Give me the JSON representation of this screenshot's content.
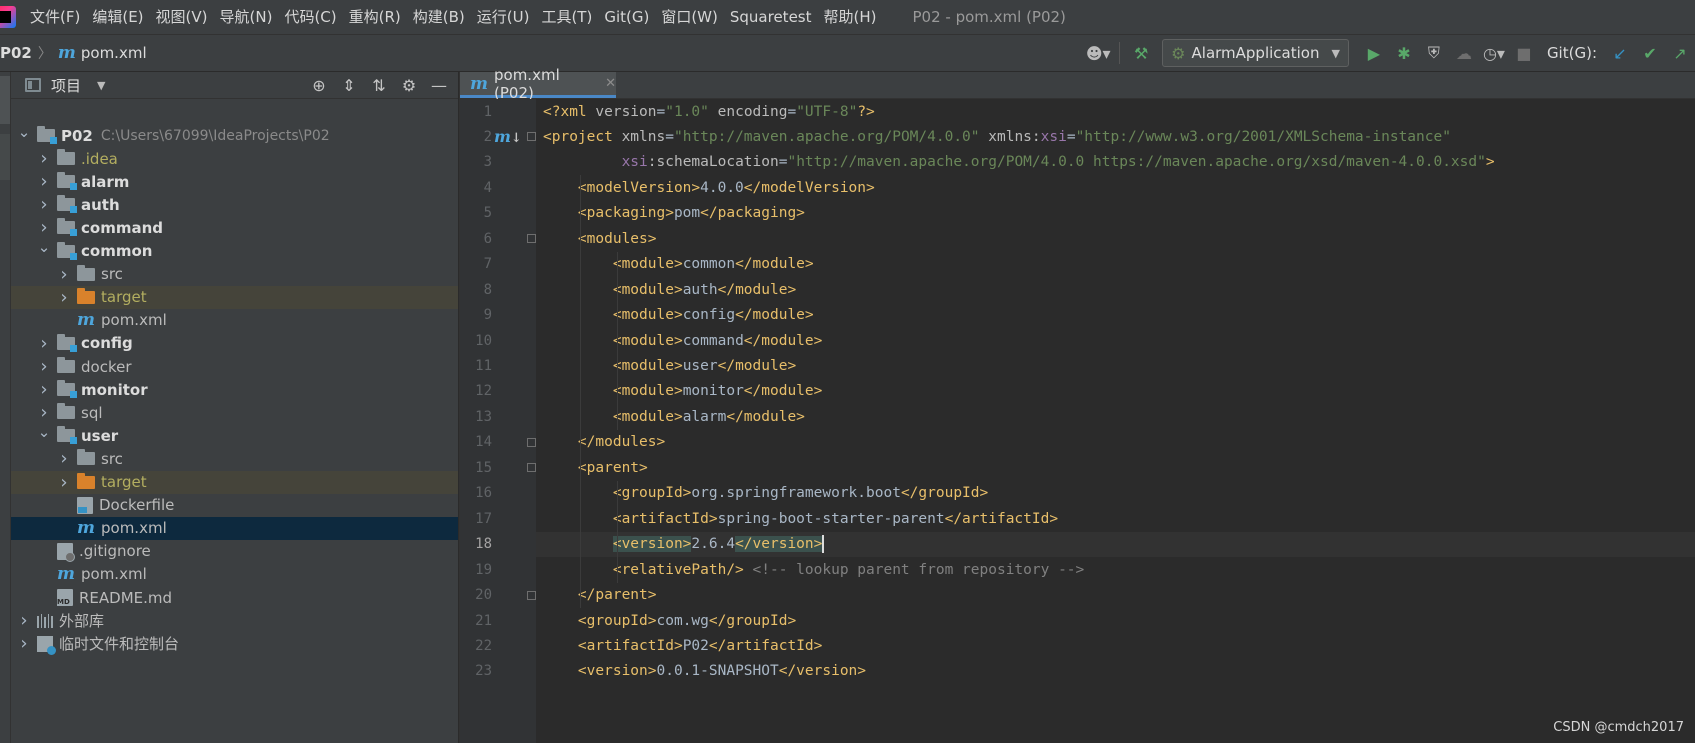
{
  "menubar": {
    "items": [
      "文件(F)",
      "编辑(E)",
      "视图(V)",
      "导航(N)",
      "代码(C)",
      "重构(R)",
      "构建(B)",
      "运行(U)",
      "工具(T)",
      "Git(G)",
      "窗口(W)",
      "Squaretest",
      "帮助(H)"
    ],
    "window_title": "P02 - pom.xml (P02)"
  },
  "navbar": {
    "root": "P02",
    "file": "pom.xml",
    "run_config": "AlarmApplication",
    "git_label": "Git(G):"
  },
  "project_panel": {
    "title": "项目",
    "tree": [
      {
        "label": "P02",
        "path": "C:\\Users\\67099\\IdeaProjects\\P02",
        "depth": 0,
        "expanded": true,
        "kind": "module",
        "bold": true
      },
      {
        "label": ".idea",
        "depth": 1,
        "expanded": false,
        "kind": "folder",
        "style": "idea"
      },
      {
        "label": "alarm",
        "depth": 1,
        "expanded": false,
        "kind": "module",
        "bold": true
      },
      {
        "label": "auth",
        "depth": 1,
        "expanded": false,
        "kind": "module",
        "bold": true
      },
      {
        "label": "command",
        "depth": 1,
        "expanded": false,
        "kind": "module",
        "bold": true
      },
      {
        "label": "common",
        "depth": 1,
        "expanded": true,
        "kind": "module",
        "bold": true
      },
      {
        "label": "src",
        "depth": 2,
        "expanded": false,
        "kind": "folder"
      },
      {
        "label": "target",
        "depth": 2,
        "expanded": false,
        "kind": "folder-orange",
        "style": "target",
        "highlight": true
      },
      {
        "label": "pom.xml",
        "depth": 2,
        "kind": "maven"
      },
      {
        "label": "config",
        "depth": 1,
        "expanded": false,
        "kind": "module",
        "bold": true
      },
      {
        "label": "docker",
        "depth": 1,
        "expanded": false,
        "kind": "folder"
      },
      {
        "label": "monitor",
        "depth": 1,
        "expanded": false,
        "kind": "module",
        "bold": true
      },
      {
        "label": "sql",
        "depth": 1,
        "expanded": false,
        "kind": "folder"
      },
      {
        "label": "user",
        "depth": 1,
        "expanded": true,
        "kind": "module",
        "bold": true
      },
      {
        "label": "src",
        "depth": 2,
        "expanded": false,
        "kind": "folder"
      },
      {
        "label": "target",
        "depth": 2,
        "expanded": false,
        "kind": "folder-orange",
        "style": "target",
        "highlight": true
      },
      {
        "label": "Dockerfile",
        "depth": 2,
        "kind": "docker"
      },
      {
        "label": "pom.xml",
        "depth": 2,
        "kind": "maven",
        "selected": true
      },
      {
        "label": ".gitignore",
        "depth": 1,
        "kind": "git"
      },
      {
        "label": "pom.xml",
        "depth": 1,
        "kind": "maven"
      },
      {
        "label": "README.md",
        "depth": 1,
        "kind": "md"
      },
      {
        "label": "外部库",
        "depth": 0,
        "expanded": false,
        "kind": "lib"
      },
      {
        "label": "临时文件和控制台",
        "depth": 0,
        "expanded": false,
        "kind": "scratch"
      }
    ]
  },
  "editor": {
    "tab_label": "pom.xml (P02)",
    "current_line": 18,
    "lines": [
      [
        [
          "tag",
          "<?xml "
        ],
        [
          "attr",
          "version"
        ],
        [
          "txt",
          "="
        ],
        [
          "val",
          "\"1.0\""
        ],
        [
          "txt",
          " "
        ],
        [
          "attr",
          "encoding"
        ],
        [
          "txt",
          "="
        ],
        [
          "val",
          "\"UTF-8\""
        ],
        [
          "tag",
          "?>"
        ]
      ],
      [
        [
          "tag",
          "<project "
        ],
        [
          "attr",
          "xmlns"
        ],
        [
          "txt",
          "="
        ],
        [
          "val",
          "\"http://maven.apache.org/POM/4.0.0\""
        ],
        [
          "txt",
          " "
        ],
        [
          "attr",
          "xmlns:"
        ],
        [
          "ns",
          "xsi"
        ],
        [
          "txt",
          "="
        ],
        [
          "val",
          "\"http://www.w3.org/2001/XMLSchema-instance\""
        ]
      ],
      [
        [
          "txt",
          "         "
        ],
        [
          "ns",
          "xsi"
        ],
        [
          "attr",
          ":schemaLocation"
        ],
        [
          "txt",
          "="
        ],
        [
          "val",
          "\"http://maven.apache.org/POM/4.0.0 https://maven.apache.org/xsd/maven-4.0.0.xsd\""
        ],
        [
          "tag",
          ">"
        ]
      ],
      [
        [
          "txt",
          "    "
        ],
        [
          "tag",
          "<modelVersion>"
        ],
        [
          "txt",
          "4.0.0"
        ],
        [
          "tag",
          "</modelVersion>"
        ]
      ],
      [
        [
          "txt",
          "    "
        ],
        [
          "tag",
          "<packaging>"
        ],
        [
          "txt",
          "pom"
        ],
        [
          "tag",
          "</packaging>"
        ]
      ],
      [
        [
          "txt",
          "    "
        ],
        [
          "tag",
          "<modules>"
        ]
      ],
      [
        [
          "txt",
          "        "
        ],
        [
          "tag",
          "<module>"
        ],
        [
          "txt",
          "common"
        ],
        [
          "tag",
          "</module>"
        ]
      ],
      [
        [
          "txt",
          "        "
        ],
        [
          "tag",
          "<module>"
        ],
        [
          "txt",
          "auth"
        ],
        [
          "tag",
          "</module>"
        ]
      ],
      [
        [
          "txt",
          "        "
        ],
        [
          "tag",
          "<module>"
        ],
        [
          "txt",
          "config"
        ],
        [
          "tag",
          "</module>"
        ]
      ],
      [
        [
          "txt",
          "        "
        ],
        [
          "tag",
          "<module>"
        ],
        [
          "txt",
          "command"
        ],
        [
          "tag",
          "</module>"
        ]
      ],
      [
        [
          "txt",
          "        "
        ],
        [
          "tag",
          "<module>"
        ],
        [
          "txt",
          "user"
        ],
        [
          "tag",
          "</module>"
        ]
      ],
      [
        [
          "txt",
          "        "
        ],
        [
          "tag",
          "<module>"
        ],
        [
          "txt",
          "monitor"
        ],
        [
          "tag",
          "</module>"
        ]
      ],
      [
        [
          "txt",
          "        "
        ],
        [
          "tag",
          "<module>"
        ],
        [
          "txt",
          "alarm"
        ],
        [
          "tag",
          "</module>"
        ]
      ],
      [
        [
          "txt",
          "    "
        ],
        [
          "tag",
          "</modules>"
        ]
      ],
      [
        [
          "txt",
          "    "
        ],
        [
          "tag",
          "<parent>"
        ]
      ],
      [
        [
          "txt",
          "        "
        ],
        [
          "tag",
          "<groupId>"
        ],
        [
          "txt",
          "org.springframework.boot"
        ],
        [
          "tag",
          "</groupId>"
        ]
      ],
      [
        [
          "txt",
          "        "
        ],
        [
          "tag",
          "<artifactId>"
        ],
        [
          "txt",
          "spring-boot-starter-parent"
        ],
        [
          "tag",
          "</artifactId>"
        ]
      ],
      [
        [
          "txt",
          "        "
        ],
        [
          "tag-hl",
          "<version>"
        ],
        [
          "txt",
          "2.6.4"
        ],
        [
          "tag-hl",
          "</version>"
        ],
        [
          "cursor",
          ""
        ]
      ],
      [
        [
          "txt",
          "        "
        ],
        [
          "tag",
          "<relativePath/>"
        ],
        [
          "txt",
          " "
        ],
        [
          "cmt",
          "<!-- lookup parent from repository -->"
        ]
      ],
      [
        [
          "txt",
          "    "
        ],
        [
          "tag",
          "</parent>"
        ]
      ],
      [
        [
          "txt",
          "    "
        ],
        [
          "tag",
          "<groupId>"
        ],
        [
          "txt",
          "com.wg"
        ],
        [
          "tag",
          "</groupId>"
        ]
      ],
      [
        [
          "txt",
          "    "
        ],
        [
          "tag",
          "<artifactId>"
        ],
        [
          "txt",
          "P02"
        ],
        [
          "tag",
          "</artifactId>"
        ]
      ],
      [
        [
          "txt",
          "    "
        ],
        [
          "tag",
          "<version>"
        ],
        [
          "txt",
          "0.0.1-SNAPSHOT"
        ],
        [
          "tag",
          "</version>"
        ]
      ]
    ]
  },
  "watermark": "CSDN @cmdch2017"
}
